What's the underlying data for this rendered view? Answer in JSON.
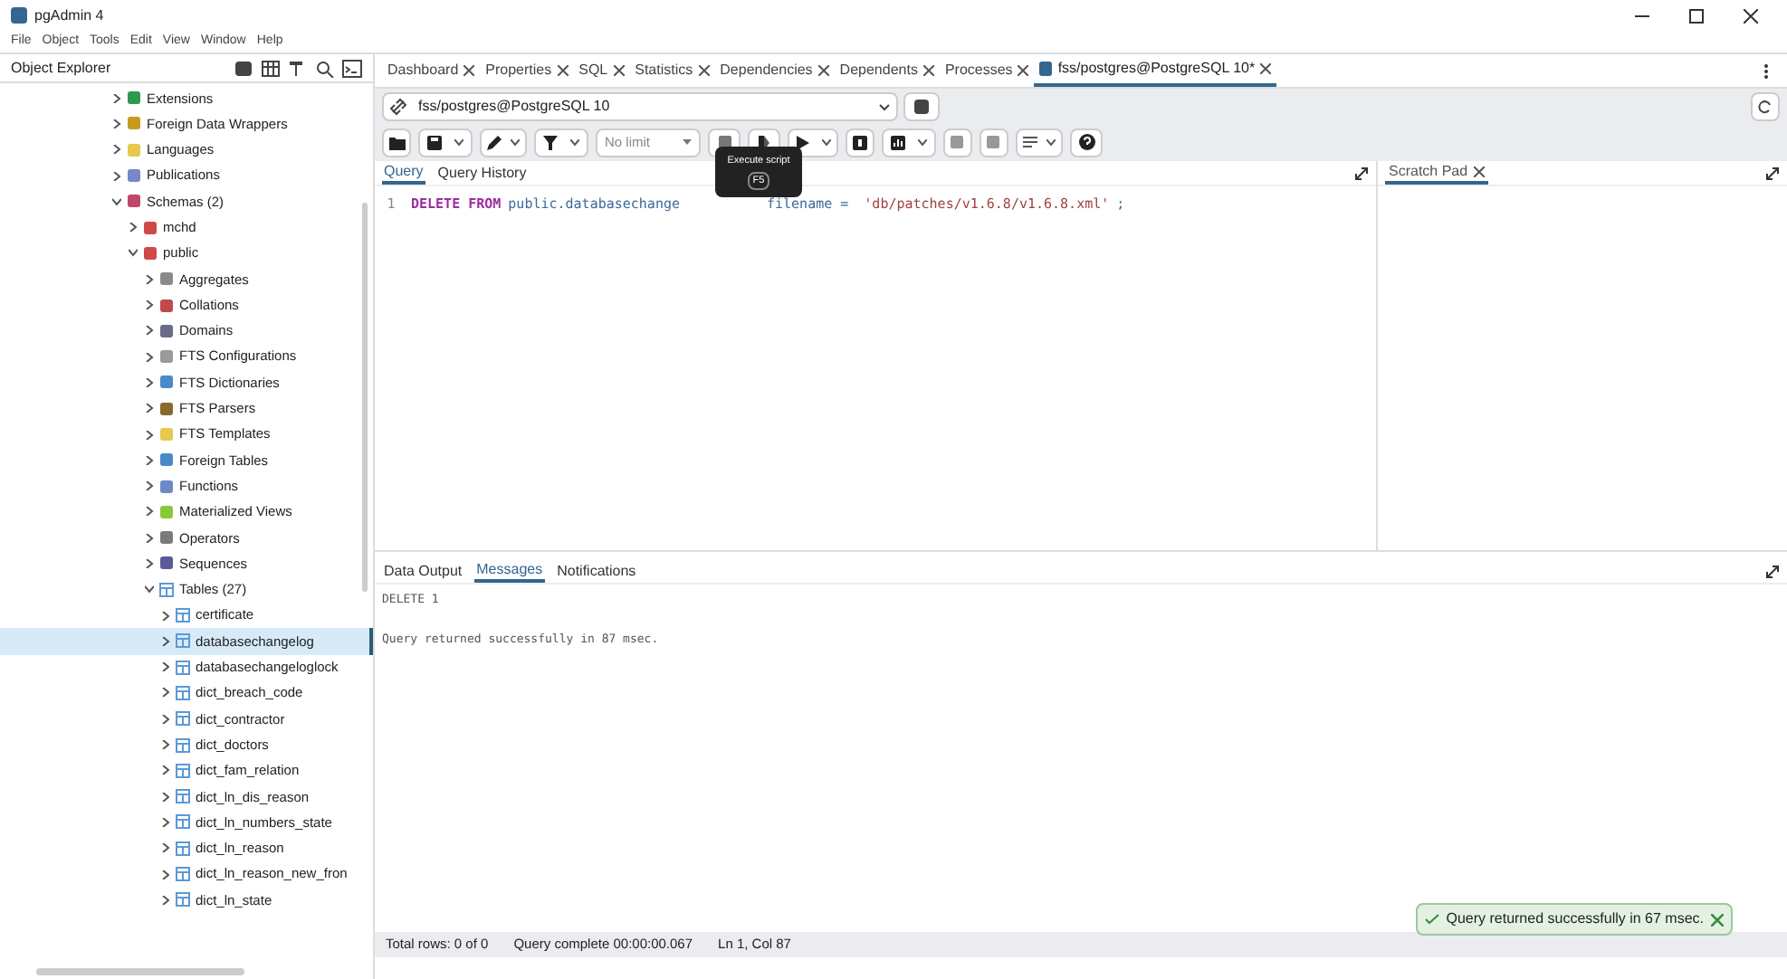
{
  "window": {
    "title": "pgAdmin 4"
  },
  "menu": [
    "File",
    "Object",
    "Tools",
    "Edit",
    "View",
    "Window",
    "Help"
  ],
  "explorer": {
    "title": "Object Explorer",
    "tree": [
      {
        "label": "Extensions",
        "kind": "extension",
        "expanded": false
      },
      {
        "label": "Foreign Data Wrappers",
        "kind": "fdw",
        "expanded": false
      },
      {
        "label": "Languages",
        "kind": "language",
        "expanded": false
      },
      {
        "label": "Publications",
        "kind": "publication",
        "expanded": false
      },
      {
        "label": "Schemas (2)",
        "kind": "schemas",
        "expanded": true,
        "children": [
          {
            "label": "mchd",
            "kind": "schema",
            "expanded": false
          },
          {
            "label": "public",
            "kind": "schema",
            "expanded": true,
            "children": [
              {
                "label": "Aggregates",
                "kind": "aggregate",
                "expanded": false
              },
              {
                "label": "Collations",
                "kind": "collation",
                "expanded": false
              },
              {
                "label": "Domains",
                "kind": "domain",
                "expanded": false
              },
              {
                "label": "FTS Configurations",
                "kind": "fts",
                "expanded": false
              },
              {
                "label": "FTS Dictionaries",
                "kind": "ftsdict",
                "expanded": false
              },
              {
                "label": "FTS Parsers",
                "kind": "parser",
                "expanded": false
              },
              {
                "label": "FTS Templates",
                "kind": "template",
                "expanded": false
              },
              {
                "label": "Foreign Tables",
                "kind": "ftable",
                "expanded": false
              },
              {
                "label": "Functions",
                "kind": "function",
                "expanded": false
              },
              {
                "label": "Materialized Views",
                "kind": "mview",
                "expanded": false
              },
              {
                "label": "Operators",
                "kind": "operator",
                "expanded": false
              },
              {
                "label": "Sequences",
                "kind": "sequence",
                "expanded": false
              },
              {
                "label": "Tables (27)",
                "kind": "table",
                "expanded": true,
                "children": [
                  {
                    "label": "certificate",
                    "kind": "table",
                    "expanded": false,
                    "selected": false
                  },
                  {
                    "label": "databasechangelog",
                    "kind": "table",
                    "expanded": false,
                    "selected": true
                  },
                  {
                    "label": "databasechangeloglock",
                    "kind": "table",
                    "expanded": false,
                    "selected": false
                  },
                  {
                    "label": "dict_breach_code",
                    "kind": "table",
                    "expanded": false,
                    "selected": false
                  },
                  {
                    "label": "dict_contractor",
                    "kind": "table",
                    "expanded": false,
                    "selected": false
                  },
                  {
                    "label": "dict_doctors",
                    "kind": "table",
                    "expanded": false,
                    "selected": false
                  },
                  {
                    "label": "dict_fam_relation",
                    "kind": "table",
                    "expanded": false,
                    "selected": false
                  },
                  {
                    "label": "dict_ln_dis_reason",
                    "kind": "table",
                    "expanded": false,
                    "selected": false
                  },
                  {
                    "label": "dict_ln_numbers_state",
                    "kind": "table",
                    "expanded": false,
                    "selected": false
                  },
                  {
                    "label": "dict_ln_reason",
                    "kind": "table",
                    "expanded": false,
                    "selected": false
                  },
                  {
                    "label": "dict_ln_reason_new_fron",
                    "kind": "table",
                    "expanded": false,
                    "selected": false
                  },
                  {
                    "label": "dict_ln_state",
                    "kind": "table",
                    "expanded": false,
                    "selected": false
                  }
                ]
              }
            ]
          }
        ]
      }
    ]
  },
  "tabs": [
    {
      "label": "Dashboard",
      "selected": false
    },
    {
      "label": "Properties",
      "selected": false
    },
    {
      "label": "SQL",
      "selected": false
    },
    {
      "label": "Statistics",
      "selected": false
    },
    {
      "label": "Dependencies",
      "selected": false
    },
    {
      "label": "Dependents",
      "selected": false
    },
    {
      "label": "Processes",
      "selected": false
    },
    {
      "label": "fss/postgres@PostgreSQL 10*",
      "selected": true
    }
  ],
  "connection": "fss/postgres@PostgreSQL 10",
  "limit": "No limit",
  "tooltip": {
    "title": "Execute script",
    "key": "F5"
  },
  "editor_tabs": [
    {
      "label": "Query",
      "selected": true
    },
    {
      "label": "Query History",
      "selected": false
    }
  ],
  "code": {
    "line": "1",
    "tokens": [
      {
        "kind": "keyword",
        "text": "DELETE FROM"
      },
      {
        "kind": "plain",
        "text": "public.databasechange"
      },
      {
        "kind": "plain",
        "text": "filename = "
      },
      {
        "kind": "string",
        "text": "'db/patches/v1.6.8/v1.6.8.xml'"
      },
      {
        "kind": "plain",
        "text": ";"
      }
    ]
  },
  "scratch_pad": {
    "title": "Scratch Pad"
  },
  "output_tabs": [
    {
      "label": "Data Output",
      "selected": false
    },
    {
      "label": "Messages",
      "selected": true
    },
    {
      "label": "Notifications",
      "selected": false
    }
  ],
  "messages": [
    "DELETE 1",
    "Query returned successfully in 87 msec."
  ],
  "status_bar": [
    "Total rows: 0 of 0",
    "Query complete 00:00:00.067",
    "Ln 1, Col 87"
  ],
  "toast": "Query returned successfully in 67 msec."
}
